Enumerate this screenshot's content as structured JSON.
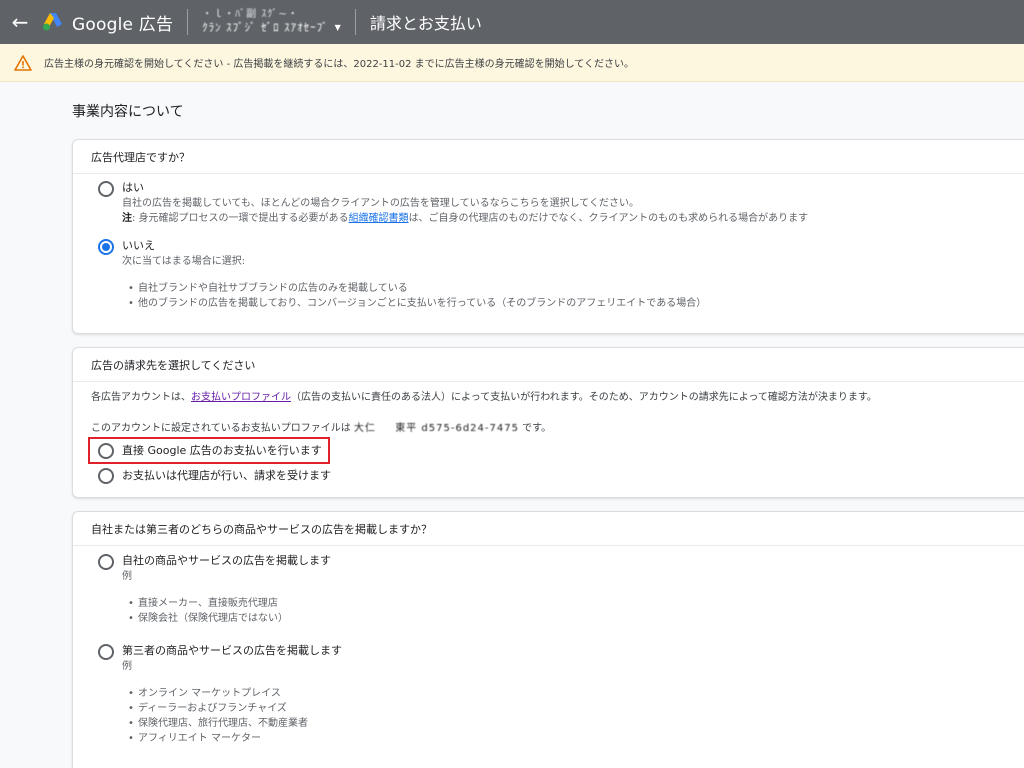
{
  "header": {
    "brand_name": "Google 広告",
    "account_line1": "・ｌ・ﾊﾞ副 ｽｸﾞ~・",
    "account_line2": "ｸﾗﾝ ｽﾌﾞｼﾞ ｾﾞﾛ ｽｱｵｾｰﾌﾞ",
    "page_name": "請求とお支払い",
    "colors": {
      "bar": "#5f6368",
      "accent": "#1a73e8"
    }
  },
  "warning": {
    "text": "広告主様の身元確認を開始してください - 広告掲載を継続するには、2022-11-02 までに広告主様の身元確認を開始してください。"
  },
  "main": {
    "section_title": "事業内容について"
  },
  "agency_card": {
    "title": "広告代理店ですか？",
    "yes_label": "はい",
    "yes_desc": "自社の広告を掲載していても、ほとんどの場合クライアントの広告を管理しているならこちらを選択してください。",
    "note_prefix": "注",
    "note_text1": ": 身元確認プロセスの一環で提出する必要がある",
    "note_link": "組織確認書類",
    "note_text2": "は、ご自身の代理店のものだけでなく、クライアントのものも求められる場合があります",
    "no_label": "いいえ",
    "no_desc": "次に当てはまる場合に選択:",
    "no_bullets": [
      "自社ブランドや自社サブブランドの広告のみを掲載している",
      "他のブランドの広告を掲載しており、コンバージョンごとに支払いを行っている（そのブランドのアフェリエイトである場合）"
    ],
    "selected": "いいえ"
  },
  "billing_card": {
    "title": "広告の請求先を選択してください",
    "desc_prefix": "各広告アカウントは、",
    "desc_link": "お支払いプロファイル",
    "desc_suffix": "（広告の支払いに責任のある法人）によって支払いが行われます。そのため、アカウントの請求先によって確認方法が決まります。",
    "profile_prefix": "このアカウントに設定されているお支払いプロファイルは",
    "profile_name": "大仁 　 東平 d575-6d24-7475",
    "profile_suffix": "です。",
    "option_direct": "直接 Google 広告のお支払いを行います",
    "option_agency": "お支払いは代理店が行い、請求を受けます"
  },
  "products_card": {
    "title": "自社または第三者のどちらの商品やサービスの広告を掲載しますか？",
    "own_label": "自社の商品やサービスの広告を掲載します",
    "own_example": "例",
    "own_bullets": [
      "直接メーカー、直接販売代理店",
      "保険会社（保険代理店ではない）"
    ],
    "third_label": "第三者の商品やサービスの広告を掲載します",
    "third_example": "例",
    "third_bullets": [
      "オンライン マーケットプレイス",
      "ディーラーおよびフランチャイズ",
      "保険代理店、旅行代理店、不動産業者",
      "アフィリエイト マーケター"
    ]
  }
}
